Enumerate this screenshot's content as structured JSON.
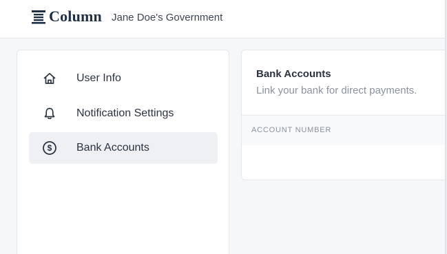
{
  "header": {
    "brand": "Column",
    "org_name": "Jane Doe's Government",
    "logo_icon": "column-logo-icon"
  },
  "sidebar": {
    "items": [
      {
        "label": "User Info",
        "icon": "home-icon",
        "active": false
      },
      {
        "label": "Notification Settings",
        "icon": "bell-icon",
        "active": false
      },
      {
        "label": "Bank Accounts",
        "icon": "dollar-circle-icon",
        "active": true
      }
    ]
  },
  "main": {
    "card": {
      "title": "Bank Accounts",
      "subtitle": "Link your bank for direct payments.",
      "columns": [
        "ACCOUNT NUMBER"
      ]
    }
  },
  "colors": {
    "brand_navy": "#1f2f46",
    "active_item_bg": "#eef0f3",
    "page_bg": "#f6f7f9",
    "muted_text": "#8a929e"
  }
}
